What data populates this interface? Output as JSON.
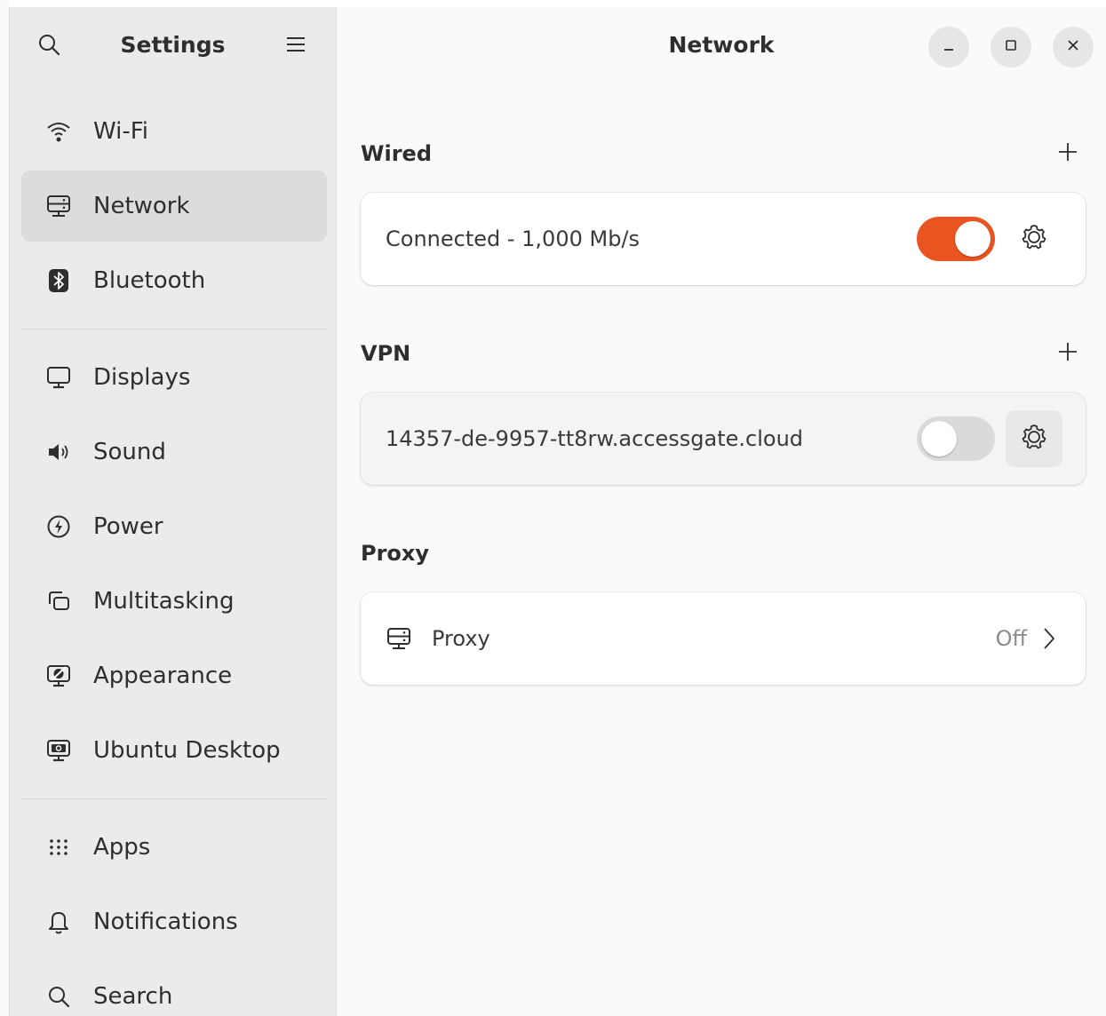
{
  "sidebar": {
    "title": "Settings",
    "search_icon": "search-icon",
    "menu_icon": "hamburger-menu-icon",
    "groups": [
      [
        {
          "label": "Wi-Fi",
          "icon": "wifi-icon",
          "selected": false
        },
        {
          "label": "Network",
          "icon": "network-icon",
          "selected": true
        },
        {
          "label": "Bluetooth",
          "icon": "bluetooth-icon",
          "selected": false
        }
      ],
      [
        {
          "label": "Displays",
          "icon": "display-icon",
          "selected": false
        },
        {
          "label": "Sound",
          "icon": "speaker-icon",
          "selected": false
        },
        {
          "label": "Power",
          "icon": "power-icon",
          "selected": false
        },
        {
          "label": "Multitasking",
          "icon": "multitasking-icon",
          "selected": false
        },
        {
          "label": "Appearance",
          "icon": "appearance-icon",
          "selected": false
        },
        {
          "label": "Ubuntu Desktop",
          "icon": "ubuntu-desktop-icon",
          "selected": false
        }
      ],
      [
        {
          "label": "Apps",
          "icon": "apps-grid-icon",
          "selected": false
        },
        {
          "label": "Notifications",
          "icon": "bell-icon",
          "selected": false
        },
        {
          "label": "Search",
          "icon": "search-icon",
          "selected": false
        }
      ]
    ]
  },
  "header": {
    "title": "Network"
  },
  "wired": {
    "heading": "Wired",
    "status": "Connected - 1,000 Mb/s",
    "enabled": true
  },
  "vpn": {
    "heading": "VPN",
    "name": "14357-de-9957-tt8rw.accessgate.cloud",
    "enabled": false
  },
  "proxy": {
    "heading": "Proxy",
    "label": "Proxy",
    "status": "Off"
  },
  "colors": {
    "accent": "#e95420",
    "toggle_off": "#dadada",
    "icon": "#2e2e2e"
  }
}
